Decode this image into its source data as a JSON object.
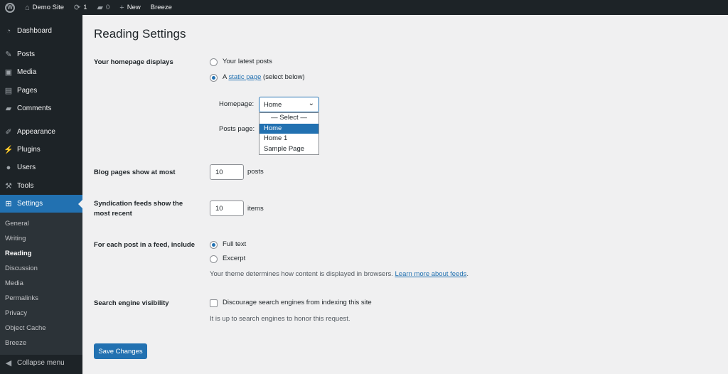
{
  "adminbar": {
    "site": "Demo Site",
    "updates": "1",
    "comments": "0",
    "new": "New",
    "plugin": "Breeze"
  },
  "sidebar": {
    "items": [
      "Dashboard",
      "Posts",
      "Media",
      "Pages",
      "Comments",
      "Appearance",
      "Plugins",
      "Users",
      "Tools",
      "Settings"
    ],
    "submenu": [
      "General",
      "Writing",
      "Reading",
      "Discussion",
      "Media",
      "Permalinks",
      "Privacy",
      "Object Cache",
      "Breeze"
    ],
    "collapse": "Collapse menu"
  },
  "page": {
    "title": "Reading Settings",
    "homepage_displays": {
      "label": "Your homepage displays",
      "opt_latest": "Your latest posts",
      "opt_static_prefix": "A ",
      "opt_static_link": "static page",
      "opt_static_suffix": " (select below)",
      "selected": "static"
    },
    "homepage_label": "Homepage:",
    "homepage_value": "Home",
    "posts_page_label": "Posts page:",
    "dropdown_options": [
      "— Select —",
      "Home",
      "Home 1",
      "Sample Page"
    ],
    "dropdown_highlighted": "Home",
    "blog_pages": {
      "label": "Blog pages show at most",
      "value": "10",
      "unit": "posts"
    },
    "syndication": {
      "label": "Syndication feeds show the most recent",
      "value": "10",
      "unit": "items"
    },
    "feed_include": {
      "label": "For each post in a feed, include",
      "opt_full": "Full text",
      "opt_excerpt": "Excerpt",
      "selected": "full",
      "desc": "Your theme determines how content is displayed in browsers. ",
      "link": "Learn more about feeds",
      "desc_end": "."
    },
    "search": {
      "label": "Search engine visibility",
      "checkbox": "Discourage search engines from indexing this site",
      "checked": false,
      "desc": "It is up to search engines to honor this request."
    },
    "save": "Save Changes"
  },
  "colors": {
    "accent": "#2271b1",
    "sidebar": "#1d2327"
  }
}
